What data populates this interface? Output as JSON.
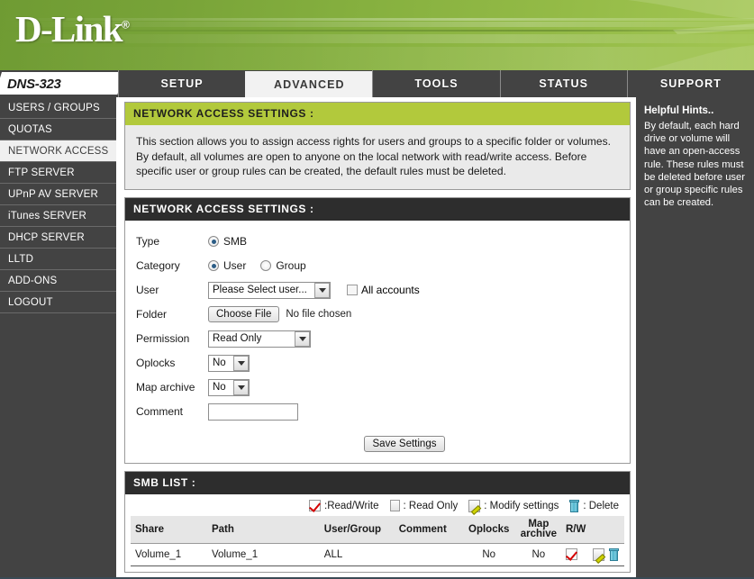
{
  "brand": {
    "logo": "D-Link",
    "registered": "®",
    "model": "DNS-323"
  },
  "nav": {
    "tabs": [
      {
        "label": "SETUP",
        "active": false
      },
      {
        "label": "ADVANCED",
        "active": true
      },
      {
        "label": "TOOLS",
        "active": false
      },
      {
        "label": "STATUS",
        "active": false
      },
      {
        "label": "SUPPORT",
        "active": false
      }
    ]
  },
  "sidebar": {
    "items": [
      {
        "label": "USERS / GROUPS",
        "active": false
      },
      {
        "label": "QUOTAS",
        "active": false
      },
      {
        "label": "NETWORK ACCESS",
        "active": true
      },
      {
        "label": "FTP SERVER",
        "active": false
      },
      {
        "label": "UPnP AV SERVER",
        "active": false
      },
      {
        "label": "iTunes SERVER",
        "active": false
      },
      {
        "label": "DHCP SERVER",
        "active": false
      },
      {
        "label": "LLTD",
        "active": false
      },
      {
        "label": "ADD-ONS",
        "active": false
      },
      {
        "label": "LOGOUT",
        "active": false
      }
    ]
  },
  "hints": {
    "title": "Helpful Hints..",
    "body": "By default, each hard drive or volume will have an open-access rule. These rules must be deleted before user or group specific rules can be created."
  },
  "info_panel": {
    "title": "NETWORK ACCESS SETTINGS :",
    "text": "This section allows you to assign access rights for users and groups to a specific folder or volumes. By default, all volumes are open to anyone on the local network with read/write access. Before specific user or group rules can be created, the default rules must be deleted."
  },
  "settings_panel": {
    "title": "NETWORK ACCESS SETTINGS :",
    "type": {
      "label": "Type",
      "option_smb": "SMB",
      "selected": "SMB"
    },
    "category": {
      "label": "Category",
      "option_user": "User",
      "option_group": "Group",
      "selected": "User"
    },
    "user": {
      "label": "User",
      "select_value": "Please Select user...",
      "all_accounts_label": "All accounts",
      "all_accounts_checked": false
    },
    "folder": {
      "label": "Folder",
      "button_label": "Choose File",
      "file_status": "No file chosen"
    },
    "permission": {
      "label": "Permission",
      "value": "Read Only"
    },
    "oplocks": {
      "label": "Oplocks",
      "value": "No"
    },
    "map_archive": {
      "label": "Map archive",
      "value": "No"
    },
    "comment": {
      "label": "Comment",
      "value": ""
    },
    "save_button": "Save Settings"
  },
  "smb_list": {
    "title": "SMB LIST :",
    "legend": [
      {
        "icon": "readwrite-check-icon",
        "text": ":Read/Write"
      },
      {
        "icon": "readonly-box-icon",
        "text": ": Read Only"
      },
      {
        "icon": "modify-settings-icon",
        "text": ": Modify settings"
      },
      {
        "icon": "delete-trash-icon",
        "text": ": Delete"
      }
    ],
    "columns": [
      "Share",
      "Path",
      "User/Group",
      "Comment",
      "Oplocks",
      "Map archive",
      "R/W"
    ],
    "rows": [
      {
        "share": "Volume_1",
        "path": "Volume_1",
        "user_group": "ALL",
        "comment": "",
        "oplocks": "No",
        "map_archive": "No",
        "rw": "read-write"
      }
    ]
  },
  "colors": {
    "brand_green": "#86b03f",
    "panel_green": "#b2c93c",
    "dark_chrome": "#434343",
    "panel_dark": "#2d2d2d",
    "check_red": "#d40000",
    "trash_cyan": "#4fb4cd"
  }
}
